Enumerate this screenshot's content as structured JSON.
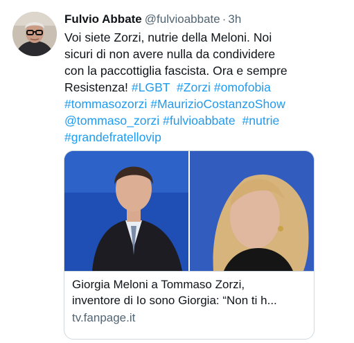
{
  "author": {
    "display_name": "Fulvio Abbate",
    "handle": "@fulvioabbate",
    "separator": "·",
    "time": "3h"
  },
  "tweet": {
    "lines": [
      [
        {
          "t": "Voi siete Zorzi, nutrie della Meloni. Noi",
          "k": "text"
        }
      ],
      [
        {
          "t": "sicuri di non avere nulla da condividere",
          "k": "text"
        }
      ],
      [
        {
          "t": "con la paccottiglia fascista. Ora e sempre",
          "k": "text"
        }
      ],
      [
        {
          "t": "Resistenza! ",
          "k": "text"
        },
        {
          "t": "#LGBT",
          "k": "tag"
        },
        {
          "t": "  ",
          "k": "text"
        },
        {
          "t": "#Zorzi",
          "k": "tag"
        },
        {
          "t": " ",
          "k": "text"
        },
        {
          "t": "#omofobia",
          "k": "tag"
        }
      ],
      [
        {
          "t": "#tommasozorzi",
          "k": "tag"
        },
        {
          "t": " ",
          "k": "text"
        },
        {
          "t": "#MaurizioCostanzoShow",
          "k": "tag"
        }
      ],
      [
        {
          "t": "@tommaso_zorzi",
          "k": "tag"
        },
        {
          "t": " ",
          "k": "text"
        },
        {
          "t": "#fulvioabbate",
          "k": "tag"
        },
        {
          "t": "  ",
          "k": "text"
        },
        {
          "t": "#nutrie",
          "k": "tag"
        }
      ],
      [
        {
          "t": "#grandefratellovip",
          "k": "tag"
        }
      ]
    ]
  },
  "card": {
    "title_line1": "Giorgia Meloni a Tommaso Zorzi,",
    "title_line2": "inventore di Io sono Giorgia: “Non ti h...",
    "domain": "tv.fanpage.it"
  },
  "colors": {
    "link": "#1d9bf0",
    "text": "#0f1419",
    "secondary": "#536471",
    "border": "#cfd9de"
  }
}
